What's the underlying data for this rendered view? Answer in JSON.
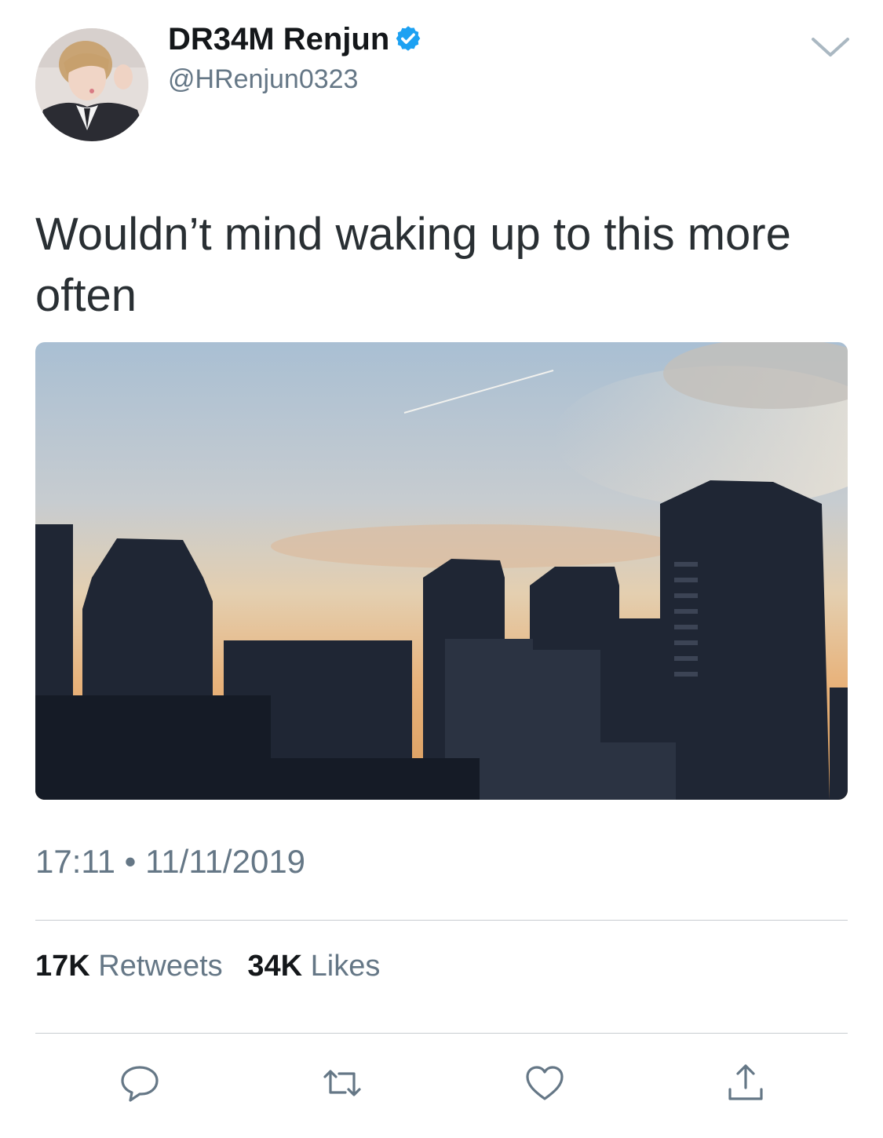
{
  "author": {
    "display_name": "DR34M Renjun",
    "handle": "@HRenjun0323",
    "verified": true,
    "avatar_icon": "profile-photo"
  },
  "tweet": {
    "text": "Wouldn’t mind waking up to this more often",
    "media_description": "sunset city skyline photo"
  },
  "meta": {
    "time": "17:11",
    "separator": "•",
    "date": "11/11/2019"
  },
  "stats": {
    "retweets_count": "17K",
    "retweets_label": "Retweets",
    "likes_count": "34K",
    "likes_label": "Likes"
  },
  "actions": {
    "reply_icon": "reply-icon",
    "retweet_icon": "retweet-icon",
    "like_icon": "heart-icon",
    "share_icon": "share-icon"
  },
  "colors": {
    "verified_blue": "#1da1f2",
    "secondary_text": "#657786",
    "primary_text": "#14171a",
    "icon_gray": "#657786"
  }
}
